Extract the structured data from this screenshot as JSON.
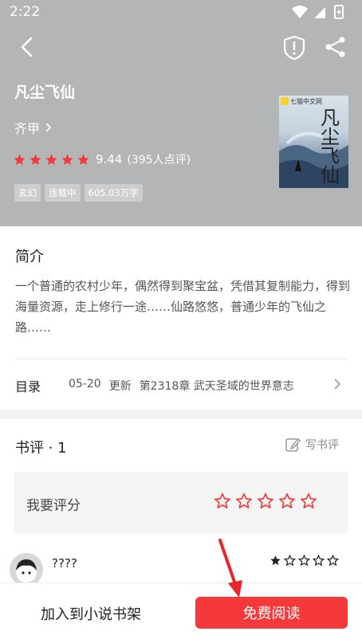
{
  "status_bar": {
    "time": "2:22"
  },
  "book": {
    "title": "凡尘飞仙",
    "author": "齐甲",
    "score": "9.44",
    "rating_count": "(395人点评)",
    "rating_stars": 5,
    "tags": [
      "玄幻",
      "连载中",
      "605.03万字"
    ],
    "cover": {
      "publisher": "七猫中文网",
      "title_calligraphy": "凡尘飞仙"
    }
  },
  "intro": {
    "heading": "简介",
    "text": "一个普通的农村少年，偶然得到聚宝盆，凭借其复制能力，得到海量资源，走上修行一途……仙路悠悠，普通少年的飞仙之路……"
  },
  "toc": {
    "label": "目录",
    "date": "05-20",
    "update": "更新",
    "latest_chapter": "第2318章 武天圣域的世界意志"
  },
  "reviews": {
    "heading": "书评 · 1",
    "write_label": "写书评",
    "rate_prompt": "我要评分",
    "items": [
      {
        "name": "????",
        "stars": 1
      }
    ]
  },
  "actions": {
    "add_to_shelf": "加入到小说书架",
    "read_free": "免费阅读"
  },
  "colors": {
    "accent_red": "#f5393b",
    "header_gray": "#b4b5b7"
  },
  "icons": [
    "back-icon",
    "shield-icon",
    "share-icon",
    "edit-icon",
    "star-icon",
    "chevron-right-icon"
  ]
}
